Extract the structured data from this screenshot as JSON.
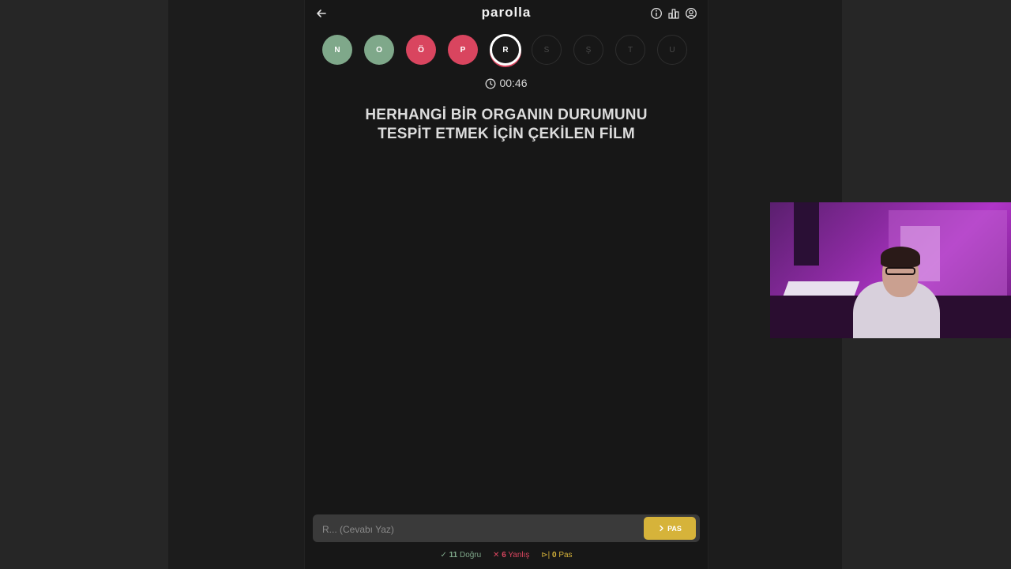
{
  "header": {
    "logo": "parolla",
    "back_icon": "arrow-left-icon",
    "icons": [
      "info-icon",
      "stats-icon",
      "user-icon"
    ]
  },
  "letters": [
    {
      "char": "N",
      "state": "correct"
    },
    {
      "char": "O",
      "state": "correct"
    },
    {
      "char": "Ö",
      "state": "wrong"
    },
    {
      "char": "P",
      "state": "wrong"
    },
    {
      "char": "R",
      "state": "active"
    },
    {
      "char": "S",
      "state": "pending"
    },
    {
      "char": "Ş",
      "state": "pending"
    },
    {
      "char": "T",
      "state": "pending"
    },
    {
      "char": "U",
      "state": "pending"
    }
  ],
  "timer": {
    "value": "00:46",
    "icon": "clock-icon"
  },
  "question": {
    "line1": "HERHANGİ BİR ORGANIN DURUMUNU",
    "line2": "TESPİT ETMEK İÇİN ÇEKİLEN FİLM"
  },
  "answer": {
    "placeholder": "R... (Cevabı Yaz)",
    "value": "",
    "pass_label": "PAS",
    "pass_icon": "chevron-right-icon"
  },
  "stats": {
    "correct_count": "11",
    "correct_label": "Doğru",
    "wrong_count": "6",
    "wrong_label": "Yanlış",
    "pass_count": "0",
    "pass_label": "Pas"
  },
  "colors": {
    "correct": "#7fa88a",
    "wrong": "#d9455f",
    "pass": "#d6b33a",
    "background": "#171717"
  }
}
